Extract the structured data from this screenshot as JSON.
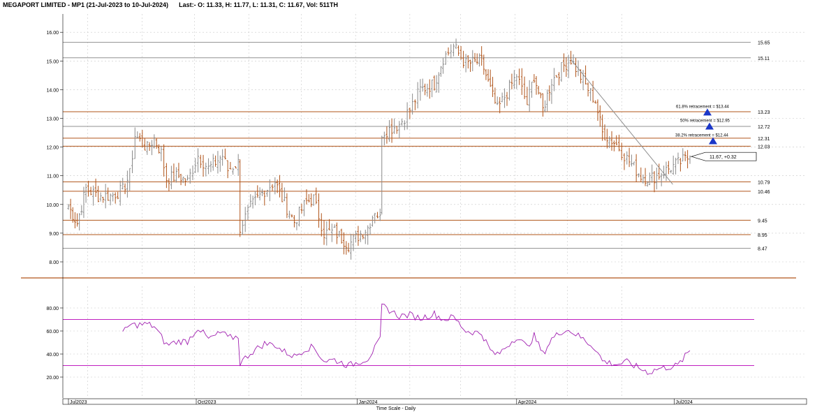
{
  "header": {
    "title": "MEGAPORT LIMITED - MP1 (21-Jul-2023 to 10-Jul-2024)",
    "quote": "Last:- O: 11.33, H: 11.77, L: 11.31, C: 11.67, Vol: 511TH"
  },
  "chart_data": [
    {
      "type": "ohlc",
      "title": "MEGAPORT LIMITED - MP1 (21-Jul-2023 to 10-Jul-2024)",
      "ylim": [
        8.0,
        16.0
      ],
      "yticks": [
        "8.00",
        "9.00",
        "10.00",
        "11.00",
        "12.00",
        "13.00",
        "14.00",
        "15.00",
        "16.00"
      ],
      "grid": true,
      "xlabel": "Time Scale - Daily",
      "xticks": [
        "Jul2023",
        "Oct2023",
        "Jan2024",
        "Apr2024",
        "Jul2024"
      ],
      "close_path": [
        [
          "2023-07-21",
          9.95
        ],
        [
          "2023-07-26",
          9.35
        ],
        [
          "2023-07-31",
          10.55
        ],
        [
          "2023-08-07",
          10.3
        ],
        [
          "2023-08-14",
          10.3
        ],
        [
          "2023-08-21",
          10.5
        ],
        [
          "2023-08-25",
          11.05
        ],
        [
          "2023-08-28",
          12.4
        ],
        [
          "2023-09-04",
          11.95
        ],
        [
          "2023-09-08",
          12.3
        ],
        [
          "2023-09-12",
          11.8
        ],
        [
          "2023-09-15",
          10.9
        ],
        [
          "2023-09-22",
          11.0
        ],
        [
          "2023-09-27",
          10.8
        ],
        [
          "2023-10-03",
          11.7
        ],
        [
          "2023-10-09",
          11.25
        ],
        [
          "2023-10-17",
          11.7
        ],
        [
          "2023-10-20",
          11.2
        ],
        [
          "2023-10-26",
          11.45
        ],
        [
          "2023-10-27",
          9.2
        ],
        [
          "2023-11-02",
          9.9
        ],
        [
          "2023-11-10",
          10.5
        ],
        [
          "2023-11-16",
          10.8
        ],
        [
          "2023-11-20",
          10.2
        ],
        [
          "2023-11-27",
          9.4
        ],
        [
          "2023-12-04",
          10.1
        ],
        [
          "2023-12-08",
          10.2
        ],
        [
          "2023-12-14",
          9.0
        ],
        [
          "2023-12-20",
          9.05
        ],
        [
          "2023-12-28",
          8.6
        ],
        [
          "2024-01-08",
          9.2
        ],
        [
          "2024-01-12",
          9.8
        ],
        [
          "2024-01-15",
          9.5
        ],
        [
          "2024-01-16",
          12.5
        ],
        [
          "2024-01-26",
          12.8
        ],
        [
          "2024-02-01",
          13.3
        ],
        [
          "2024-02-07",
          14.0
        ],
        [
          "2024-02-15",
          14.2
        ],
        [
          "2024-02-20",
          15.1
        ],
        [
          "2024-02-26",
          15.5
        ],
        [
          "2024-03-04",
          14.9
        ],
        [
          "2024-03-13",
          15.0
        ],
        [
          "2024-03-18",
          14.0
        ],
        [
          "2024-03-22",
          13.3
        ],
        [
          "2024-04-02",
          14.5
        ],
        [
          "2024-04-08",
          13.5
        ],
        [
          "2024-04-12",
          14.5
        ],
        [
          "2024-04-17",
          13.3
        ],
        [
          "2024-04-22",
          14.3
        ],
        [
          "2024-04-29",
          14.85
        ],
        [
          "2024-05-03",
          15.05
        ],
        [
          "2024-05-10",
          14.3
        ],
        [
          "2024-05-17",
          13.6
        ],
        [
          "2024-05-21",
          12.5
        ],
        [
          "2024-05-29",
          12.1
        ],
        [
          "2024-06-04",
          11.6
        ],
        [
          "2024-06-12",
          11.0
        ],
        [
          "2024-06-17",
          10.9
        ],
        [
          "2024-06-21",
          11.0
        ],
        [
          "2024-07-10",
          11.67
        ]
      ],
      "horizontal_levels": [
        {
          "label": "15.65",
          "value": 15.65,
          "color": "#909090"
        },
        {
          "label": "15.11",
          "value": 15.11,
          "color": "#909090"
        },
        {
          "label": "13.23",
          "value": 13.23,
          "color": "#b0541a"
        },
        {
          "label": "12.72",
          "value": 12.72,
          "color": "#909090"
        },
        {
          "label": "12.31",
          "value": 12.31,
          "color": "#b0541a"
        },
        {
          "label": "12.03",
          "value": 12.03,
          "color": "#b0541a"
        },
        {
          "label": "10.79",
          "value": 10.79,
          "color": "#b0541a"
        },
        {
          "label": "10.46",
          "value": 10.46,
          "color": "#b0541a"
        },
        {
          "label": "9.45",
          "value": 9.45,
          "color": "#b0541a"
        },
        {
          "label": "8.95",
          "value": 8.95,
          "color": "#b0541a"
        },
        {
          "label": "8.47",
          "value": 8.47,
          "color": "#909090"
        }
      ],
      "annotations": [
        {
          "text": "61.8% retracement = $13.44",
          "value": 13.44
        },
        {
          "text": "50% retracement = $12.95",
          "value": 12.95
        },
        {
          "text": "38.2% retracement = $12.44",
          "value": 12.44
        },
        {
          "text": "11.67, +0.32",
          "value": 11.67
        }
      ],
      "trendline": [
        [
          "2024-05-03",
          15.05
        ],
        [
          "2024-07-01",
          10.7
        ]
      ]
    },
    {
      "type": "line",
      "ylim": [
        10,
        90
      ],
      "yticks": [
        "20.00",
        "40.00",
        "60.00",
        "80.00"
      ],
      "levels": [
        70,
        30
      ],
      "level_color": "#c020c0",
      "series": [
        {
          "color": "#a020b0",
          "values": [
            [
              "2023-08-21",
              58
            ],
            [
              "2023-08-25",
              65
            ],
            [
              "2023-09-04",
              66
            ],
            [
              "2023-09-08",
              64
            ],
            [
              "2023-09-15",
              48
            ],
            [
              "2023-09-22",
              51
            ],
            [
              "2023-09-27",
              51
            ],
            [
              "2023-10-03",
              63
            ],
            [
              "2023-10-09",
              53
            ],
            [
              "2023-10-17",
              59
            ],
            [
              "2023-10-20",
              54
            ],
            [
              "2023-10-26",
              55
            ],
            [
              "2023-10-27",
              32
            ],
            [
              "2023-11-02",
              41
            ],
            [
              "2023-11-10",
              49
            ],
            [
              "2023-11-16",
              48
            ],
            [
              "2023-11-20",
              43
            ],
            [
              "2023-11-27",
              38
            ],
            [
              "2023-12-04",
              45
            ],
            [
              "2023-12-08",
              46
            ],
            [
              "2023-12-14",
              34
            ],
            [
              "2023-12-20",
              35
            ],
            [
              "2023-12-28",
              30
            ],
            [
              "2024-01-08",
              36
            ],
            [
              "2024-01-12",
              45
            ],
            [
              "2024-01-15",
              52
            ],
            [
              "2024-01-16",
              82
            ],
            [
              "2024-01-26",
              73
            ],
            [
              "2024-02-01",
              74
            ],
            [
              "2024-02-07",
              71
            ],
            [
              "2024-02-15",
              75
            ],
            [
              "2024-02-20",
              70
            ],
            [
              "2024-02-26",
              72
            ],
            [
              "2024-03-04",
              60
            ],
            [
              "2024-03-13",
              58
            ],
            [
              "2024-03-18",
              43
            ],
            [
              "2024-03-22",
              39
            ],
            [
              "2024-04-02",
              55
            ],
            [
              "2024-04-08",
              46
            ],
            [
              "2024-04-12",
              56
            ],
            [
              "2024-04-17",
              40
            ],
            [
              "2024-04-22",
              53
            ],
            [
              "2024-04-29",
              61
            ],
            [
              "2024-05-03",
              60
            ],
            [
              "2024-05-10",
              53
            ],
            [
              "2024-05-17",
              45
            ],
            [
              "2024-05-21",
              34
            ],
            [
              "2024-05-29",
              31
            ],
            [
              "2024-06-04",
              33
            ],
            [
              "2024-06-12",
              27
            ],
            [
              "2024-06-17",
              24
            ],
            [
              "2024-06-21",
              27
            ],
            [
              "2024-07-03",
              30
            ],
            [
              "2024-07-10",
              43
            ]
          ]
        }
      ]
    }
  ],
  "colors": {
    "bar_up": "#8a8a8a",
    "bar_down": "#b0541a",
    "grid": "#c8c8c8",
    "divider": "#b0541a",
    "triangle": "#1a36c8",
    "trendline": "#909090"
  }
}
